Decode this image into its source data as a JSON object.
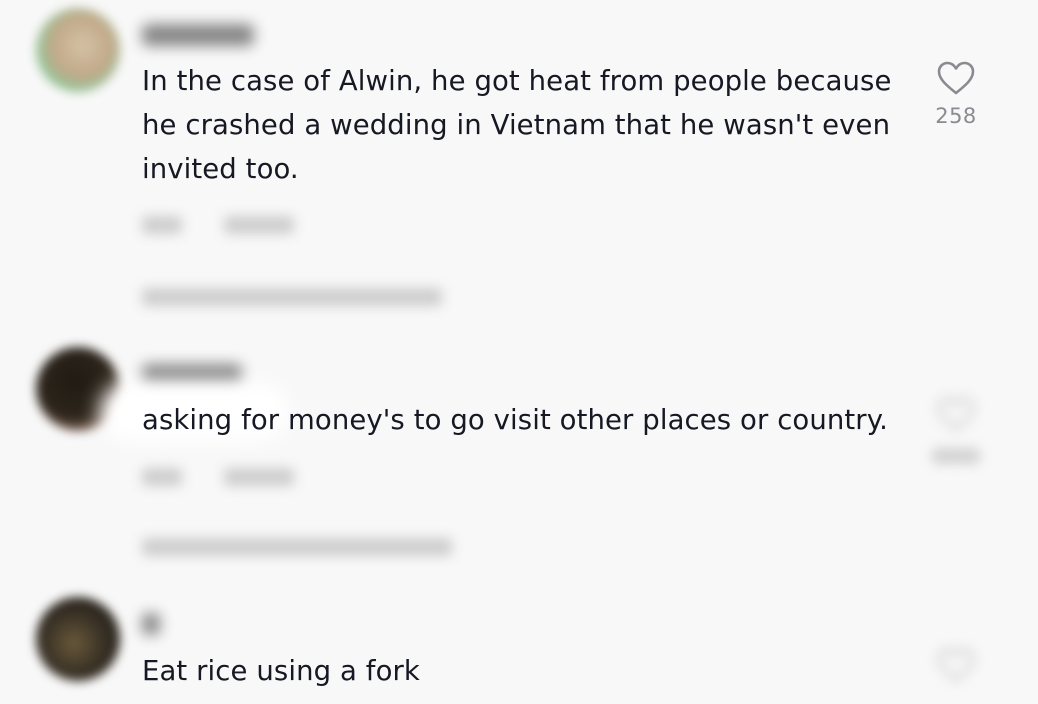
{
  "comments": [
    {
      "text": "In the case of Alwin, he got heat from people because he crashed a wedding in Vietnam that he wasn't even invited too.",
      "likes": "258",
      "avatar_colors": [
        "#c9b79a",
        "#7fcf9b"
      ]
    },
    {
      "text": "asking for money's to go visit other places or country.",
      "likes": "",
      "avatar_colors": [
        "#2a2218",
        "#c49a86"
      ]
    },
    {
      "text": "Eat rice using a fork",
      "likes": "",
      "avatar_colors": [
        "#2b2620",
        "#7a6a4a"
      ]
    }
  ],
  "icons": {
    "like": "heart-outline-icon"
  }
}
